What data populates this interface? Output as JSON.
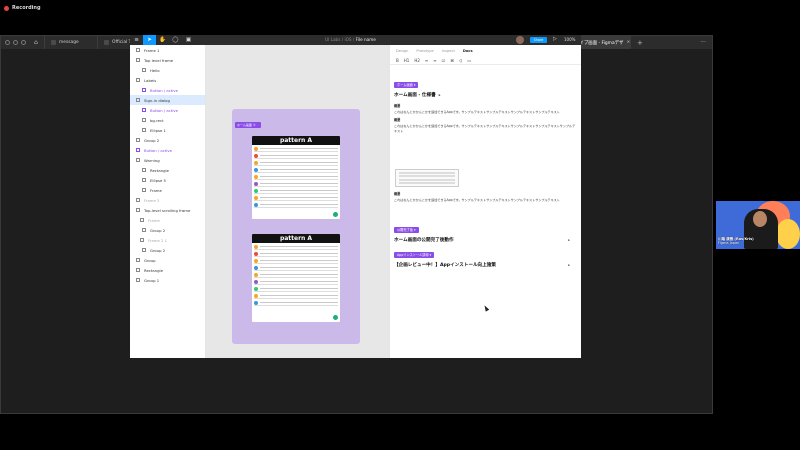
{
  "recording": {
    "label": "Recording"
  },
  "browser_tabs": [
    {
      "label": "message"
    },
    {
      "label": "Official Theme"
    },
    {
      "label": "iOS"
    },
    {
      "label": "Android"
    },
    {
      "label": "Branch-MessageApp-Security"
    },
    {
      "label": "UI-kit_PC"
    },
    {
      "label": "UIKit_SP"
    },
    {
      "label": "balance"
    },
    {
      "label": "Figmaデザインシン"
    },
    {
      "label": "BASE向プロトタイプ画面 - Figmaデザ"
    }
  ],
  "figma": {
    "breadcrumb_prefix": "UI Labs / iOS /",
    "file_name": "File name",
    "share_label": "Share",
    "zoom": "100%",
    "layers": [
      {
        "label": "Frame 1",
        "style": "normal"
      },
      {
        "label": "Top level frame",
        "style": "normal"
      },
      {
        "label": "Hello",
        "style": "normal"
      },
      {
        "label": "Labels",
        "style": "normal"
      },
      {
        "label": "Button / active",
        "style": "purple"
      },
      {
        "label": "Sign-in dialog",
        "style": "selected"
      },
      {
        "label": "Button / active",
        "style": "purple"
      },
      {
        "label": "bg-rect",
        "style": "normal"
      },
      {
        "label": "Ellipse 1",
        "style": "normal"
      },
      {
        "label": "Group 2",
        "style": "normal"
      },
      {
        "label": "Button / active",
        "style": "purple"
      },
      {
        "label": "Warning",
        "style": "normal"
      },
      {
        "label": "Rectangle",
        "style": "normal"
      },
      {
        "label": "Ellipse 5",
        "style": "normal"
      },
      {
        "label": "Frame",
        "style": "normal"
      },
      {
        "label": "Frame 3",
        "style": "grey"
      },
      {
        "label": "Top-level scrolling frame",
        "style": "normal"
      },
      {
        "label": "Frame",
        "style": "grey"
      },
      {
        "label": "Group 2",
        "style": "normal"
      },
      {
        "label": "Frame 2 1",
        "style": "grey"
      },
      {
        "label": "Group 2",
        "style": "normal"
      },
      {
        "label": "Group",
        "style": "normal"
      },
      {
        "label": "Rectangle",
        "style": "normal"
      },
      {
        "label": "Group 1",
        "style": "normal"
      }
    ],
    "canvas": {
      "frame_label": "ホーム画面 ①",
      "phones": [
        {
          "title": "pattern A"
        },
        {
          "title": "pattern A"
        }
      ]
    },
    "panel_tabs": [
      "Design",
      "Prototype",
      "Inspect",
      "Docs"
    ],
    "panel_tools": [
      "B",
      "H1",
      "H2",
      "≡",
      "≡",
      "☑",
      "⌘",
      "⟨⟩",
      "▭"
    ],
    "sections": [
      {
        "badge": "ホーム画面 ▾",
        "title": "ホーム画面 - 仕様書",
        "h1": "概要",
        "p1": "これはなんとかかんとかを追加できるAppです。サンプルテキストサンプルテキストサンプルテキストサンプルテキスト",
        "h2": "概要",
        "p2": "これはなんとかかんとかを追加できるAppです。サンプルテキストサンプルテキストサンプルテキストサンプルテキストサンプルテキスト",
        "h3": "概要",
        "p3": "これはなんとかかんとかを追加できるAppです。サンプルテキストサンプルテキストサンプルテキストサンプルテキスト"
      },
      {
        "badge": "公開完了後 ▾",
        "title": "ホーム画面の公開完了後動作"
      },
      {
        "badge": "Appインストール誘導 ▾",
        "title": "【企画レビュー中！】Appインストール向上施策"
      }
    ]
  },
  "webcam": {
    "name": "川端 康雅 (Ras/Kris)",
    "company": "Figma Japan"
  }
}
